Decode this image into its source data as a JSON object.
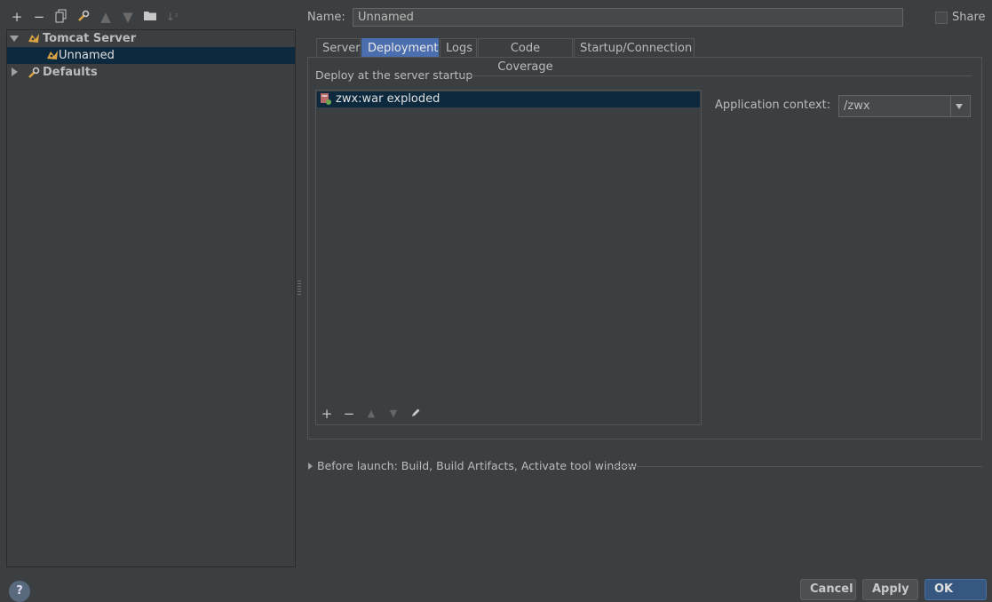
{
  "toolbar": {
    "icons": [
      "add-icon",
      "remove-icon",
      "copy-icon",
      "wrench-icon",
      "move-up-icon",
      "move-down-icon",
      "folder-icon",
      "sort-icon"
    ]
  },
  "tree": {
    "group_label": "Tomcat Server",
    "item_label": "Unnamed",
    "defaults_label": "Defaults"
  },
  "header": {
    "name_label": "Name:",
    "name_value": "Unnamed",
    "share_label": "Share"
  },
  "tabs": [
    "Server",
    "Deployment",
    "Logs",
    "Code Coverage",
    "Startup/Connection"
  ],
  "active_tab": "Deployment",
  "deployment": {
    "section_title": "Deploy at the server startup",
    "artifact": "zwx:war exploded",
    "context_label": "Application context:",
    "context_value": "/zwx"
  },
  "before_launch": "Before launch: Build, Build Artifacts, Activate tool window",
  "bottom": {
    "help": "?",
    "cancel": "Cancel",
    "apply": "Apply",
    "ok": "OK"
  }
}
